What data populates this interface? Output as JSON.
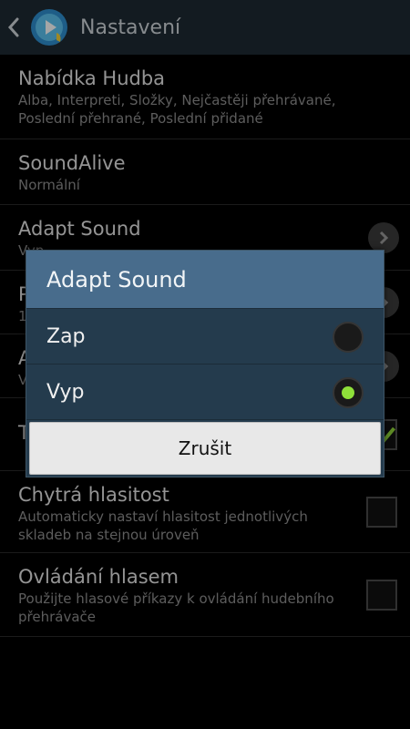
{
  "header": {
    "title": "Nastavení",
    "back_icon": "chevron-left-icon",
    "app_icon": "music-player-icon"
  },
  "settings": [
    {
      "title": "Nabídka Hudba",
      "subtitle": "Alba, Interpreti, Složky, Nejčastěji přehrávané, Poslední přehrané, Poslední přidané",
      "control": "none"
    },
    {
      "title": "SoundAlive",
      "subtitle": "Normální",
      "control": "none"
    },
    {
      "title": "Adapt Sound",
      "subtitle": "Vyp",
      "control": "chevron"
    },
    {
      "title": "P",
      "subtitle": "1",
      "control": "chevron"
    },
    {
      "title": "A",
      "subtitle": "V",
      "control": "chevron"
    },
    {
      "title": "T",
      "subtitle": "",
      "control": "checkbox",
      "checked": true
    },
    {
      "title": "Chytrá hlasitost",
      "subtitle": "Automaticky nastaví hlasitost jednotlivých skladeb na stejnou úroveň",
      "control": "checkbox",
      "checked": false
    },
    {
      "title": "Ovládání hlasem",
      "subtitle": "Použijte hlasové příkazy k ovládání hudebního přehrávače",
      "control": "checkbox",
      "checked": false
    }
  ],
  "dialog": {
    "title": "Adapt Sound",
    "options": [
      {
        "label": "Zap",
        "selected": false
      },
      {
        "label": "Vyp",
        "selected": true
      }
    ],
    "cancel_label": "Zrušit"
  },
  "colors": {
    "accent": "#8ee03a",
    "dialog_title_bg": "#486c8c",
    "dialog_bg": "#243b4d",
    "actionbar_bg": "#1e2a33"
  }
}
